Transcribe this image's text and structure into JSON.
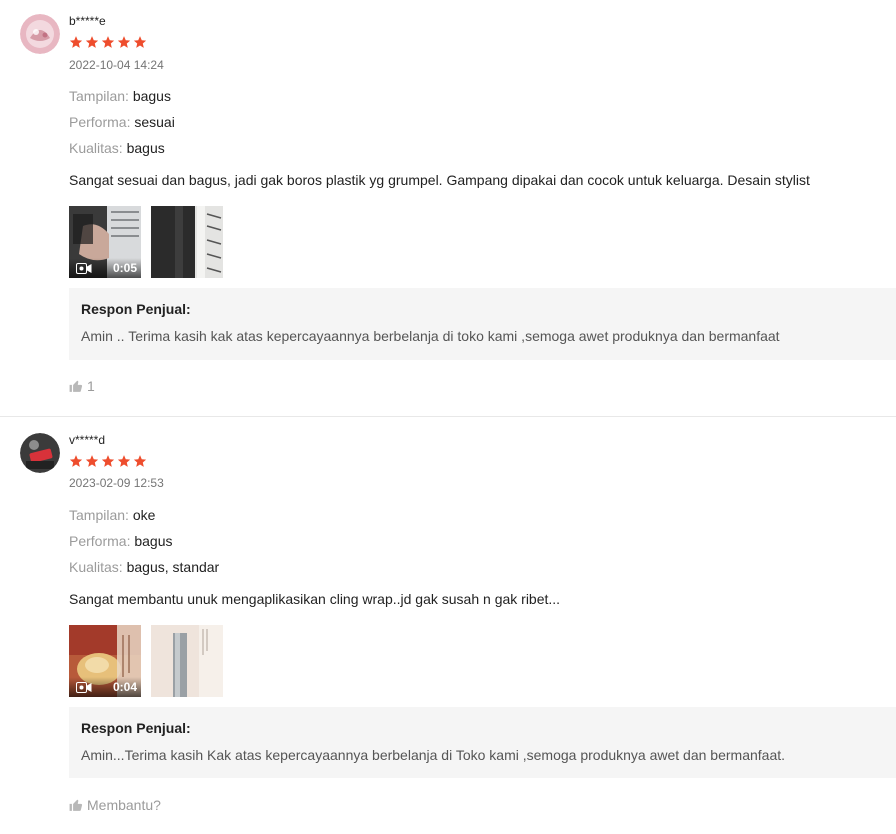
{
  "theme": {
    "star_color": "#ee4d2d",
    "response_bg": "#f5f5f5"
  },
  "reviews": [
    {
      "username": "b*****e",
      "rating": 5,
      "timestamp": "2022-10-04 14:24",
      "attrs": [
        {
          "key": "Tampilan:",
          "value": "bagus"
        },
        {
          "key": "Performa:",
          "value": "sesuai"
        },
        {
          "key": "Kualitas:",
          "value": "bagus"
        }
      ],
      "comment": "Sangat sesuai dan bagus, jadi gak boros plastik yg grumpel. Gampang dipakai dan cocok untuk keluarga. Desain stylist",
      "video_duration": "0:05",
      "seller_response": {
        "title": "Respon Penjual:",
        "body": "Amin .. Terima kasih kak atas kepercayaannya berbelanja di toko kami ,semoga awet produknya dan bermanfaat"
      },
      "like_label": "1"
    },
    {
      "username": "v*****d",
      "rating": 5,
      "timestamp": "2023-02-09 12:53",
      "attrs": [
        {
          "key": "Tampilan:",
          "value": "oke"
        },
        {
          "key": "Performa:",
          "value": "bagus"
        },
        {
          "key": "Kualitas:",
          "value": "bagus, standar"
        }
      ],
      "comment": "Sangat membantu unuk mengaplikasikan cling wrap..jd gak susah n gak ribet...",
      "video_duration": "0:04",
      "seller_response": {
        "title": "Respon Penjual:",
        "body": "Amin...Terima kasih Kak atas kepercayaannya berbelanja di Toko kami ,semoga produknya awet dan bermanfaat."
      },
      "like_label": "Membantu?"
    }
  ]
}
